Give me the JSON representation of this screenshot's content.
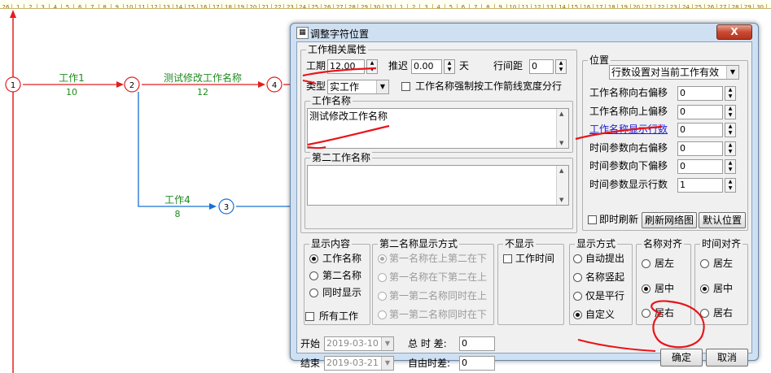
{
  "ruler": [
    "26",
    "1",
    "2",
    "3",
    "4",
    "5",
    "6",
    "7",
    "8",
    "9",
    "10",
    "11",
    "12",
    "13",
    "14",
    "15",
    "16",
    "17",
    "18",
    "19",
    "20",
    "21",
    "22",
    "23",
    "24",
    "25",
    "26",
    "27",
    "28",
    "29",
    "30",
    "31",
    "1",
    "2",
    "3",
    "4",
    "5",
    "6",
    "7",
    "8",
    "9",
    "10",
    "11",
    "12",
    "13",
    "14",
    "15",
    "16",
    "17",
    "18",
    "19",
    "20",
    "21",
    "22",
    "23",
    "24",
    "25",
    "26",
    "27",
    "28",
    "29",
    "30",
    "1"
  ],
  "network": {
    "nodes": [
      {
        "label": "1",
        "color": "#e02020"
      },
      {
        "label": "2",
        "color": "#e02020"
      },
      {
        "label": "4",
        "color": "#e02020"
      },
      {
        "label": "3",
        "color": "#1a6fd6"
      }
    ],
    "activities": [
      {
        "name": "工作1",
        "duration": "10"
      },
      {
        "name": "测试修改工作名称",
        "duration": "12"
      },
      {
        "name": "工作4",
        "duration": "8"
      }
    ],
    "colors": {
      "critical": "#e02020",
      "normal": "#1a6fd6",
      "text": "#1e8b1e"
    }
  },
  "dialog": {
    "title": "调整字符位置",
    "close_label": "X",
    "work_props": {
      "legend": "工作相关属性",
      "duration_label": "工期",
      "duration_value": "12.00",
      "delay_label": "推迟",
      "delay_value": "0.00",
      "day_label": "天",
      "row_spacing_label": "行间距",
      "row_spacing_value": "0",
      "type_label": "类型",
      "type_value": "实工作",
      "force_wrap_label": "工作名称强制按工作箭线宽度分行",
      "name_legend": "工作名称",
      "name_value": "测试修改工作名称",
      "second_name_legend": "第二工作名称",
      "second_name_value": ""
    },
    "position": {
      "legend": "位置",
      "mode_value": "行数设置对当前工作有效",
      "rows": [
        {
          "label": "工作名称向右偏移",
          "value": "0"
        },
        {
          "label": "工作名称向上偏移",
          "value": "0"
        },
        {
          "label": "工作名称显示行数",
          "value": "0"
        },
        {
          "label": "时间参数向右偏移",
          "value": "0"
        },
        {
          "label": "时间参数向下偏移",
          "value": "0"
        },
        {
          "label": "时间参数显示行数",
          "value": "1"
        }
      ],
      "instant_refresh_label": "即时刷新",
      "refresh_button": "刷新网络图",
      "default_button": "默认位置"
    },
    "display_content": {
      "legend": "显示内容",
      "options": [
        "工作名称",
        "第二名称",
        "同时显示"
      ],
      "all_work_label": "所有工作"
    },
    "second_name_mode": {
      "legend": "第二名称显示方式",
      "options": [
        "第一名称在上第二在下",
        "第一名称在下第二在上",
        "第一第二名称同时在上",
        "第一第二名称同时在下"
      ]
    },
    "hide": {
      "legend": "不显示",
      "work_time_label": "工作时间"
    },
    "display_mode": {
      "legend": "显示方式",
      "options": [
        "自动提出",
        "名称竖起",
        "仅是平行",
        "自定义"
      ]
    },
    "name_align": {
      "legend": "名称对齐",
      "options": [
        "居左",
        "居中",
        "居右"
      ]
    },
    "time_align": {
      "legend": "时间对齐",
      "options": [
        "居左",
        "居中",
        "居右"
      ]
    },
    "start_label": "开始",
    "start_value": "2019-03-10",
    "end_label": "结束",
    "end_value": "2019-03-21",
    "total_float_label": "总 时 差:",
    "total_float_value": "0",
    "free_float_label": "自由时差:",
    "free_float_value": "0",
    "ok_button": "确定",
    "cancel_button": "取消"
  }
}
